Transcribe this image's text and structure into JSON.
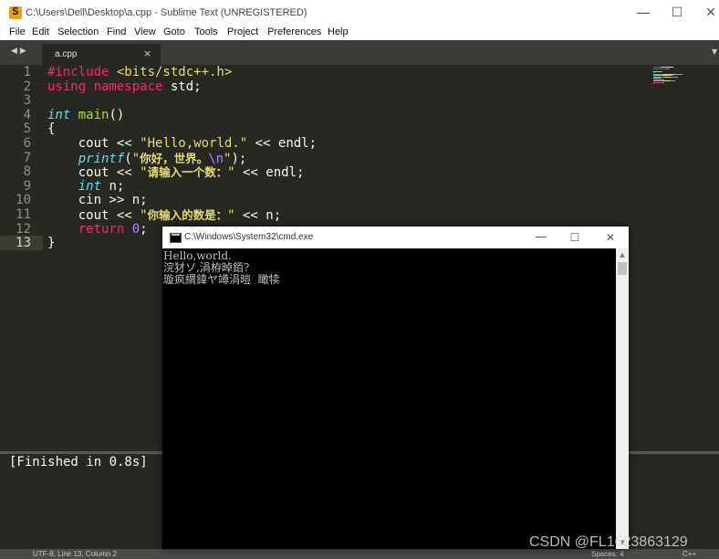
{
  "window": {
    "title": "C:\\Users\\Dell\\Desktop\\a.cpp - Sublime Text (UNREGISTERED)",
    "minimize": "—",
    "maximize": "☐",
    "close": "✕"
  },
  "menu": [
    "File",
    "Edit",
    "Selection",
    "Find",
    "View",
    "Goto",
    "Tools",
    "Project",
    "Preferences",
    "Help"
  ],
  "tabs": {
    "nav": "◀▶",
    "active": {
      "label": "a.cpp",
      "close": "×"
    },
    "dropdown": "▼"
  },
  "editor": {
    "current_line": 13,
    "line_numbers": [
      "1",
      "2",
      "3",
      "4",
      "5",
      "6",
      "7",
      "8",
      "9",
      "10",
      "11",
      "12",
      "13"
    ],
    "lines": [
      [
        {
          "t": "#include ",
          "c": "kw"
        },
        {
          "t": "<bits/stdc++.h>",
          "c": "str"
        }
      ],
      [
        {
          "t": "using ",
          "c": "kw"
        },
        {
          "t": "namespace ",
          "c": "kw"
        },
        {
          "t": "std;",
          "c": "plain"
        }
      ],
      [],
      [
        {
          "t": "int ",
          "c": "ty"
        },
        {
          "t": "main",
          "c": "fn"
        },
        {
          "t": "()",
          "c": "plain"
        }
      ],
      [
        {
          "t": "{",
          "c": "plain"
        }
      ],
      [
        {
          "t": "    cout << ",
          "c": "plain"
        },
        {
          "t": "\"Hello,world.\"",
          "c": "str"
        },
        {
          "t": " << endl;",
          "c": "plain"
        }
      ],
      [
        {
          "t": "    printf",
          "c": "ty"
        },
        {
          "t": "(",
          "c": "plain"
        },
        {
          "t": "\"",
          "c": "str"
        },
        {
          "t": "你好，世界。",
          "c": "str cjk"
        },
        {
          "t": "\\n",
          "c": "esc"
        },
        {
          "t": "\"",
          "c": "str"
        },
        {
          "t": ");",
          "c": "plain"
        }
      ],
      [
        {
          "t": "    cout << ",
          "c": "plain"
        },
        {
          "t": "\"",
          "c": "str"
        },
        {
          "t": "请输入一个数：",
          "c": "str cjk"
        },
        {
          "t": "\"",
          "c": "str"
        },
        {
          "t": " << endl;",
          "c": "plain"
        }
      ],
      [
        {
          "t": "    int ",
          "c": "ty"
        },
        {
          "t": "n;",
          "c": "plain"
        }
      ],
      [
        {
          "t": "    cin >> n;",
          "c": "plain"
        }
      ],
      [
        {
          "t": "    cout << ",
          "c": "plain"
        },
        {
          "t": "\"",
          "c": "str"
        },
        {
          "t": "你输入的数是：",
          "c": "str cjk"
        },
        {
          "t": "\"",
          "c": "str"
        },
        {
          "t": " << n;",
          "c": "plain"
        }
      ],
      [
        {
          "t": "    return ",
          "c": "kw"
        },
        {
          "t": "0",
          "c": "num"
        },
        {
          "t": ";",
          "c": "plain"
        }
      ],
      [
        {
          "t": "}",
          "c": "plain"
        }
      ]
    ]
  },
  "output_panel": {
    "text": "[Finished in 0.8s]"
  },
  "status_bar": {
    "left": "UTF-8, Line 13, Column 2",
    "middle": "Spaces: 4",
    "right": "C++"
  },
  "cmd": {
    "title": "C:\\Windows\\System32\\cmd.exe",
    "minimize": "—",
    "maximize": "☐",
    "close": "✕",
    "lines": [
      "Hello,world.",
      "浣犲ソ,涓栫晫銆?",
      "璇疯緭鍏ヤ竴涓暟  瞰犊"
    ],
    "scroll_up": "▲",
    "scroll_down": "▼"
  },
  "watermark": "CSDN @FL1623863129",
  "colors": {
    "editor_bg": "#272822",
    "keyword": "#f92672",
    "type": "#66d9ef",
    "function": "#a6e22e",
    "string": "#e6db74",
    "number": "#ae81ff"
  }
}
